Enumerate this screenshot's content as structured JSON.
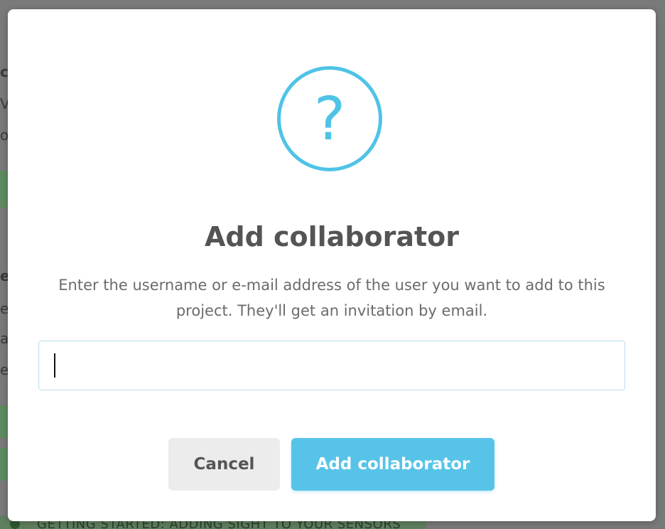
{
  "background": {
    "fragments": [
      "c",
      "V",
      "o",
      "e",
      "ea",
      "a",
      "ea"
    ],
    "bottom_banner": "GETTING STARTED: ADDING SIGHT TO YOUR SENSORS"
  },
  "dialog": {
    "icon": "question-mark-circle-icon",
    "icon_glyph": "?",
    "icon_color": "#4fc3e6",
    "title": "Add collaborator",
    "description": "Enter the username or e-mail address of the user you want to add to this project. They'll get an invitation by email.",
    "input": {
      "value": "",
      "placeholder": ""
    },
    "buttons": {
      "cancel_label": "Cancel",
      "confirm_label": "Add collaborator",
      "confirm_color": "#57c3e8"
    }
  }
}
